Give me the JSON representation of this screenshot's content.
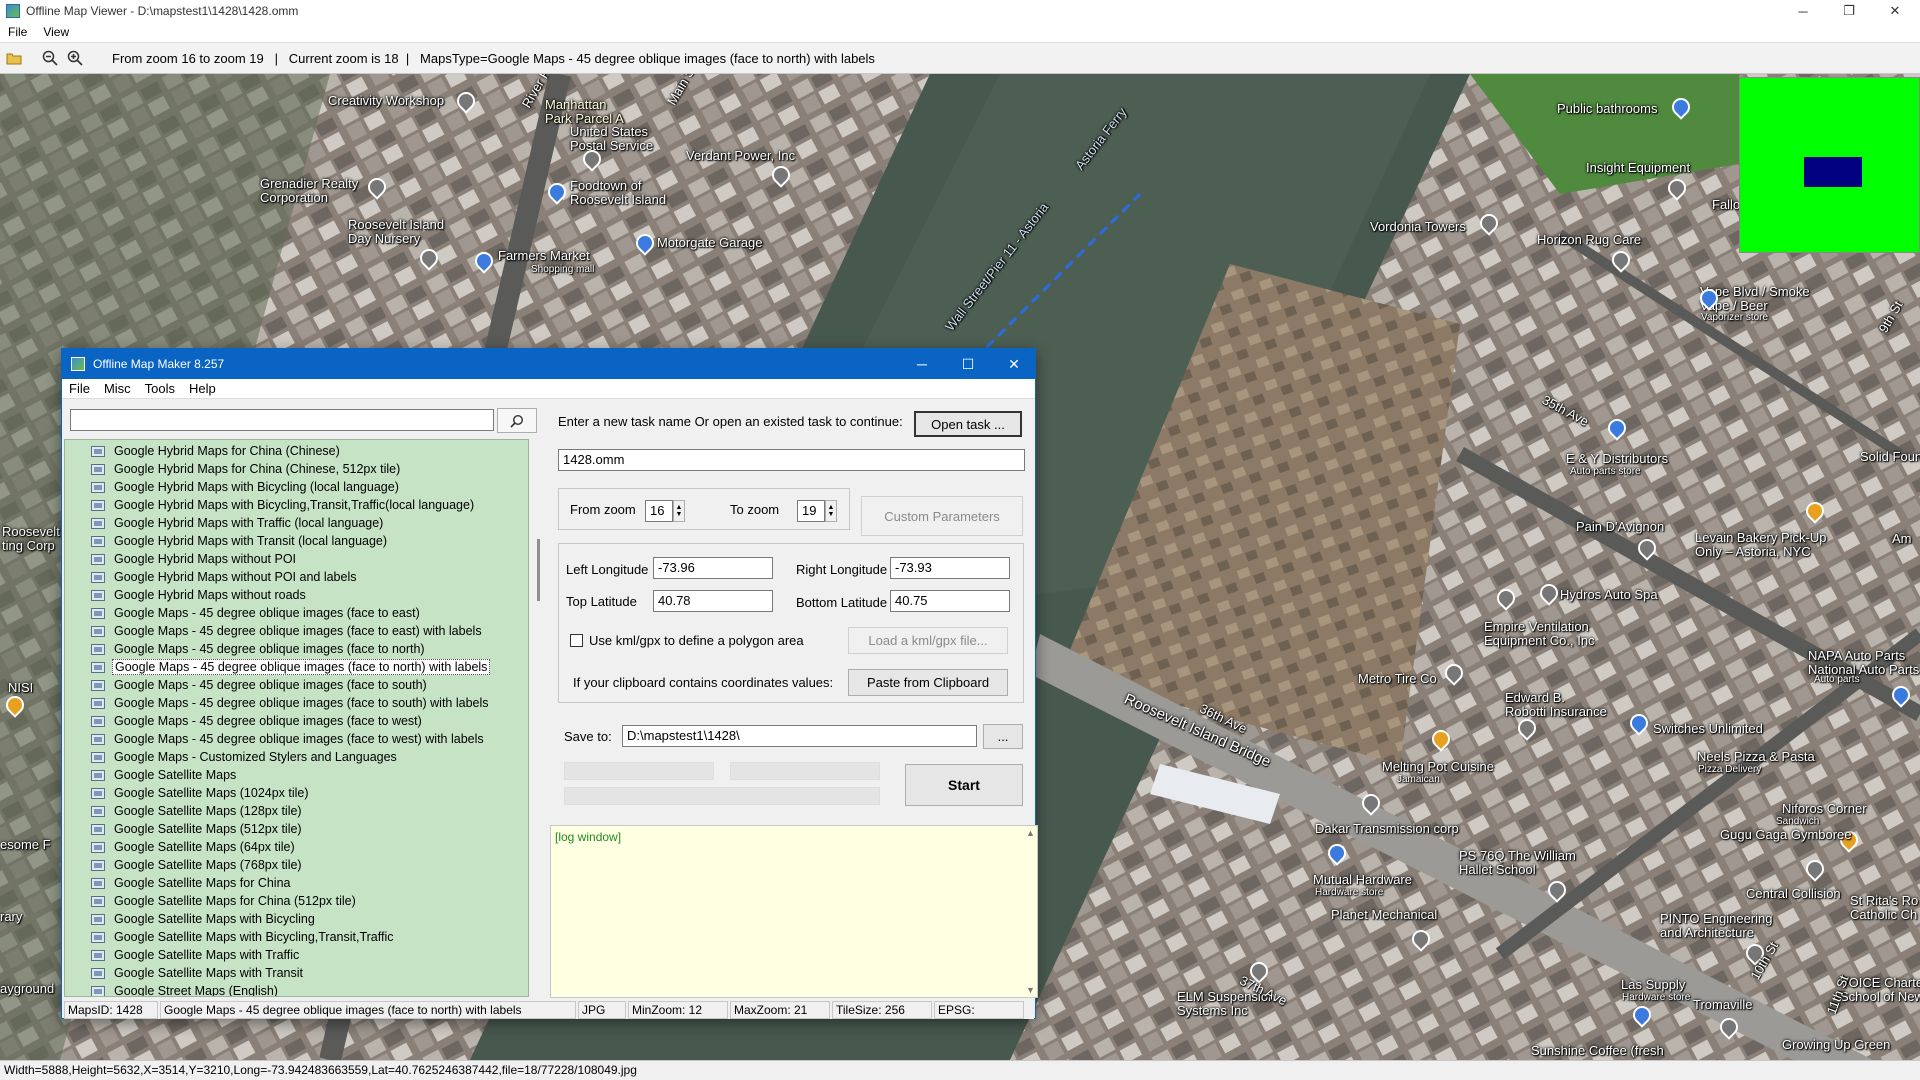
{
  "window": {
    "title": "Offline Map Viewer - D:\\mapstest1\\1428\\1428.omm"
  },
  "menu": [
    "File",
    "View"
  ],
  "toolbar": {
    "info": "From zoom 16 to zoom 19   |   Current zoom is 18  |   MapsType=Google Maps - 45 degree oblique images (face to north) with labels"
  },
  "status": "Width=5888,Height=5632,X=3514,Y=3210,Long=-73.942483663559,Lat=40.7625246387442,file=18/77228/108049.jpg",
  "map_labels": [
    {
      "t": "Creativity Workshop",
      "pin": "#777"
    },
    {
      "t": "Manhattan\nPark Parcel A"
    },
    {
      "t": "United States\nPostal Service",
      "pin": "#777"
    },
    {
      "t": "Verdant Power, Inc",
      "pin": "#777"
    },
    {
      "t": "Grenadier Realty\nCorporation",
      "pin": "#777"
    },
    {
      "t": "Foodtown of\nRoosevelt Island",
      "pin": "#3b7be0"
    },
    {
      "t": "Roosevelt Island\nDay Nursery",
      "pin": "#777"
    },
    {
      "t": "Farmers Market"
    },
    {
      "t": "Shopping mall"
    },
    {
      "t": "Motorgate Garage",
      "pin": "#3b7be0"
    },
    {
      "t": "Main St"
    },
    {
      "t": "River Rd"
    },
    {
      "t": "Wall Street/Pier 11 - Astoria"
    },
    {
      "t": "Astoria Ferry"
    },
    {
      "t": "Public bathrooms",
      "pin": "#3b7be0"
    },
    {
      "t": "Insight Equipment",
      "pin": "#777"
    },
    {
      "t": "Vordonia Towers",
      "pin": "#777"
    },
    {
      "t": "Horizon Rug Care",
      "pin": "#777"
    },
    {
      "t": "Vape Blvd / Smoke\nVape / Beer",
      "pin": "#3b7be0"
    },
    {
      "t": "Vaporizer store"
    },
    {
      "t": "35th Ave"
    },
    {
      "t": "E & Y Distributors",
      "pin": "#3b7be0"
    },
    {
      "t": "Auto parts store"
    },
    {
      "t": "Pain D'Avignon",
      "pin": "#777"
    },
    {
      "t": "Levain Bakery Pick-Up\nOnly – Astoria, NYC",
      "pin": "#e8a020"
    },
    {
      "t": "Hydros Auto Spa",
      "pin": "#777"
    },
    {
      "t": "Empire Ventilation\nEquipment Co., Inc",
      "pin": "#777"
    },
    {
      "t": "Roosevelt Island Bridge"
    },
    {
      "t": "36th Ave"
    },
    {
      "t": "Metro Tire Co",
      "pin": "#777"
    },
    {
      "t": "Edward B.\nRobotti Insurance",
      "pin": "#777"
    },
    {
      "t": "Switches Unlimited",
      "pin": "#3b7be0"
    },
    {
      "t": "NAPA Auto Parts\nNational Auto Parts",
      "pin": "#3b7be0"
    },
    {
      "t": "Melting Pot Cuisine",
      "pin": "#e8a020"
    },
    {
      "t": "Jamaican"
    },
    {
      "t": "Neels Pizza & Pasta"
    },
    {
      "t": "Pizza Delivery"
    },
    {
      "t": "Niforos Corner",
      "pin": "#e8a020"
    },
    {
      "t": "Dakar Transmission corp",
      "pin": "#777"
    },
    {
      "t": "Gugu Gaga Gymboree",
      "pin": "#777"
    },
    {
      "t": "PS 76Q The William\nHallet School",
      "pin": "#777"
    },
    {
      "t": "Mutual Hardware",
      "pin": "#3b7be0"
    },
    {
      "t": "Hardware store"
    },
    {
      "t": "Central Collision",
      "pin": "#777"
    },
    {
      "t": "Planet Mechanical",
      "pin": "#777"
    },
    {
      "t": "PINTO Engineering\nand Architecture",
      "pin": "#777"
    },
    {
      "t": "St Rita's Ro\nCatholic Ch"
    },
    {
      "t": "ELM Suspension\nSystems Inc",
      "pin": "#777"
    },
    {
      "t": "Las Supply",
      "pin": "#3b7be0"
    },
    {
      "t": "Hardware store"
    },
    {
      "t": "Tromaville",
      "pin": "#777"
    },
    {
      "t": "VOICE Charte\nSchool of New Yor"
    },
    {
      "t": "Sunshine Coffee (fresh"
    },
    {
      "t": "Growing Up Green"
    },
    {
      "t": "37th Ave"
    },
    {
      "t": "Solid Founda"
    },
    {
      "t": "9th St"
    },
    {
      "t": "10th St"
    },
    {
      "t": "11th St"
    },
    {
      "t": "Roosevelt\nting Corp"
    },
    {
      "t": "NISI"
    },
    {
      "t": "esome F"
    },
    {
      "t": "rary"
    },
    {
      "t": "ayground"
    },
    {
      "t": "Fallo"
    },
    {
      "t": "Am"
    },
    {
      "t": "Auto parts"
    },
    {
      "t": "Sandwich"
    }
  ],
  "dialog": {
    "title": "Offline Map Maker 8.257",
    "menu": [
      "File",
      "Misc",
      "Tools",
      "Help"
    ],
    "search_value": "",
    "maps_list": [
      "Google Hybrid Maps for China (Chinese)",
      "Google Hybrid Maps for China (Chinese, 512px tile)",
      "Google Hybrid Maps with Bicycling (local language)",
      "Google Hybrid Maps with Bicycling,Transit,Traffic(local language)",
      "Google Hybrid Maps with Traffic (local language)",
      "Google Hybrid Maps with Transit (local language)",
      "Google Hybrid Maps without POI",
      "Google Hybrid Maps without POI and labels",
      "Google Hybrid Maps without roads",
      "Google Maps - 45 degree oblique images (face to east)",
      "Google Maps - 45 degree oblique images (face to east) with labels",
      "Google Maps - 45 degree oblique images (face to north)",
      "Google Maps - 45 degree oblique images (face to north) with labels",
      "Google Maps - 45 degree oblique images (face to south)",
      "Google Maps - 45 degree oblique images (face to south) with labels",
      "Google Maps - 45 degree oblique images (face to west)",
      "Google Maps - 45 degree oblique images (face to west) with labels",
      "Google Maps - Customized Stylers and Languages",
      "Google Satellite Maps",
      "Google Satellite Maps (1024px tile)",
      "Google Satellite Maps (128px tile)",
      "Google Satellite Maps (512px tile)",
      "Google Satellite Maps (64px tile)",
      "Google Satellite Maps (768px tile)",
      "Google Satellite Maps for China",
      "Google Satellite Maps for China (512px tile)",
      "Google Satellite Maps with Bicycling",
      "Google Satellite Maps with Bicycling,Transit,Traffic",
      "Google Satellite Maps with Traffic",
      "Google Satellite Maps with Transit",
      "Google Street Maps (English)"
    ],
    "selected_index": 12,
    "task_prompt": "Enter a new task name Or open an existed task to continue:",
    "open_task_label": "Open task ...",
    "task_name": "1428.omm",
    "from_zoom_label": "From zoom",
    "from_zoom": "16",
    "to_zoom_label": "To zoom",
    "to_zoom": "19",
    "custom_params_label": "Custom Parameters",
    "left_lon_label": "Left Longitude",
    "left_lon": "-73.96",
    "right_lon_label": "Right Longitude",
    "right_lon": "-73.93",
    "top_lat_label": "Top Latitude",
    "top_lat": "40.78",
    "bottom_lat_label": "Bottom Latitude",
    "bottom_lat": "40.75",
    "kml_label": "Use kml/gpx to define a polygon area",
    "load_kml_label": "Load a kml/gpx file...",
    "clipboard_label": "If your clipboard contains coordinates values:",
    "paste_label": "Paste from Clipboard",
    "save_to_label": "Save to:",
    "save_to": "D:\\mapstest1\\1428\\",
    "browse_label": "...",
    "start_label": "Start",
    "log_text": "[log window]",
    "status": {
      "maps_id": "MapsID: 1428",
      "maps_name": "Google Maps - 45 degree oblique images (face to north) with labels",
      "format": "JPG",
      "min_zoom": "MinZoom: 12",
      "max_zoom": "MaxZoom: 21",
      "tile_size": "TileSize: 256",
      "epsg": "EPSG:"
    }
  }
}
